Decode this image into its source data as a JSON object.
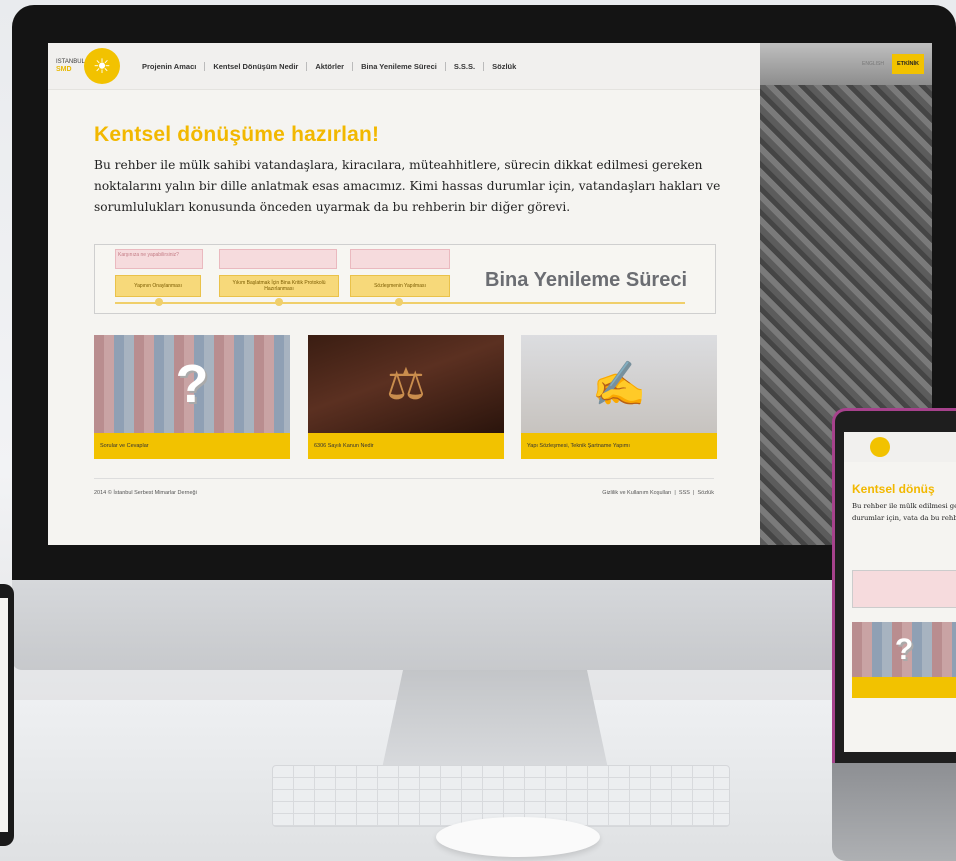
{
  "site": {
    "logo": {
      "city": "ISTANBUL",
      "brand": "SMD"
    },
    "nav": [
      "Projenin Amacı",
      "Kentsel Dönüşüm Nedir",
      "Aktörler",
      "Bina Yenileme Süreci",
      "S.S.S.",
      "Sözlük"
    ],
    "lang": "ENGLISH",
    "cta": "ETKİNİK",
    "hero_title": "Kentsel dönüşüme hazırlan!",
    "hero_text": "Bu rehber ile mülk sahibi vatandaşlara, kiracılara, müteahhitlere, sürecin dikkat edilmesi gereken noktalarını yalın bir dille anlatmak esas amacımız. Kimi hassas durumlar için, vatandaşları hakları ve sorumlulukları konusunda önceden uyarmak da bu rehberin bir diğer görevi.",
    "banner": {
      "title": "Bina Yenileme Süreci",
      "top_chip": "Karşınıza ne yapabilirsiniz?",
      "chips": [
        "Yapının Onaylanması",
        "Yıkım Başlatmak İçin Bina Kritik Protokolü Hazırlanması",
        "Sözleşmenin Yapılması"
      ]
    },
    "cards": [
      {
        "caption": "Sorular ve Cevaplar"
      },
      {
        "caption": "6306 Sayılı Kanun Nedir"
      },
      {
        "caption": "Yapı Sözleşmesi, Teknik Şartname Yapımı"
      }
    ],
    "footer_left": "2014 © İstanbul Serbest Mimarlar Derneği",
    "footer_right": [
      "Gizlilik ve Kullanım Koşulları",
      "SSS",
      "Sözlük"
    ]
  },
  "laptop": {
    "hero_title": "Kentsel dönüş",
    "hero_text": "Bu rehber ile mülk edilmesi gereken n durumlar için, vata da bu rehberin bir"
  }
}
